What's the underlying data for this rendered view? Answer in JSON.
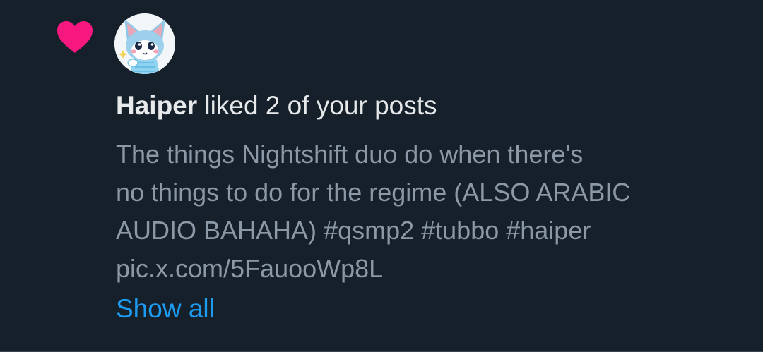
{
  "notification": {
    "type_icon": "heart-icon",
    "avatar_icon": "cat-avatar-icon",
    "actor_name": "Haiper",
    "action_text": " liked 2 of your posts",
    "post_lines": [
      "The things Nightshift duo do when there's",
      "no things to do for the regime (ALSO ARABIC",
      "AUDIO BAHAHA) #qsmp2 #tubbo #haiper",
      "pic.x.com/5FauooWp8L"
    ],
    "show_all_label": "Show all"
  },
  "colors": {
    "background": "#15202b",
    "heart": "#f91880",
    "primary_text": "#e7e9ea",
    "secondary_text": "#8b98a5",
    "link": "#1d9bf0",
    "divider": "#38444d"
  }
}
